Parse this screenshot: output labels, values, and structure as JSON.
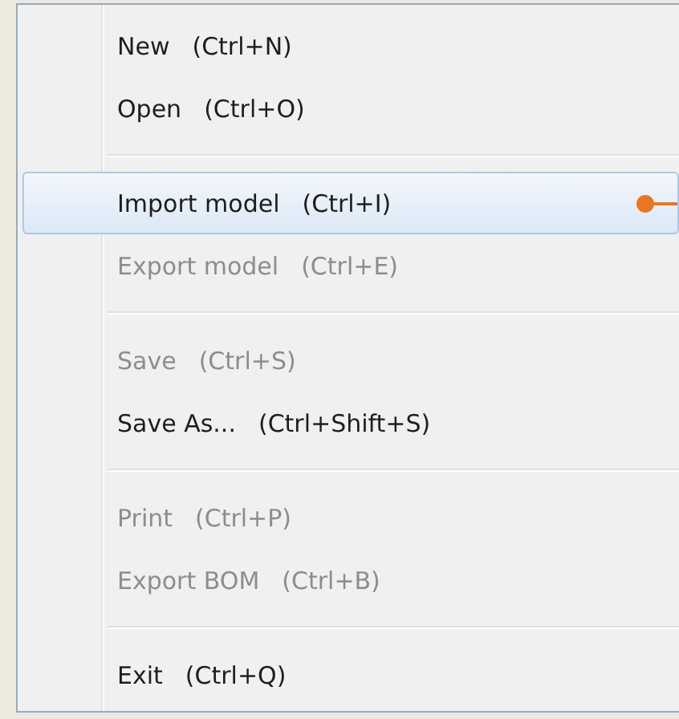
{
  "menu": {
    "items": [
      {
        "kind": "item",
        "label": "New",
        "shortcut": "(Ctrl+N)",
        "disabled": false,
        "selected": false,
        "callout": false
      },
      {
        "kind": "item",
        "label": "Open",
        "shortcut": "(Ctrl+O)",
        "disabled": false,
        "selected": false,
        "callout": false
      },
      {
        "kind": "separator"
      },
      {
        "kind": "item",
        "label": "Import model",
        "shortcut": "(Ctrl+I)",
        "disabled": false,
        "selected": true,
        "callout": true
      },
      {
        "kind": "item",
        "label": "Export model",
        "shortcut": "(Ctrl+E)",
        "disabled": true,
        "selected": false,
        "callout": false
      },
      {
        "kind": "separator"
      },
      {
        "kind": "item",
        "label": "Save",
        "shortcut": "(Ctrl+S)",
        "disabled": true,
        "selected": false,
        "callout": false
      },
      {
        "kind": "item",
        "label": "Save As...",
        "shortcut": "(Ctrl+Shift+S)",
        "disabled": false,
        "selected": false,
        "callout": false
      },
      {
        "kind": "separator"
      },
      {
        "kind": "item",
        "label": "Print",
        "shortcut": "(Ctrl+P)",
        "disabled": true,
        "selected": false,
        "callout": false
      },
      {
        "kind": "item",
        "label": "Export BOM",
        "shortcut": "(Ctrl+B)",
        "disabled": true,
        "selected": false,
        "callout": false
      },
      {
        "kind": "separator"
      },
      {
        "kind": "item",
        "label": "Exit",
        "shortcut": "(Ctrl+Q)",
        "disabled": false,
        "selected": false,
        "callout": false
      }
    ]
  }
}
